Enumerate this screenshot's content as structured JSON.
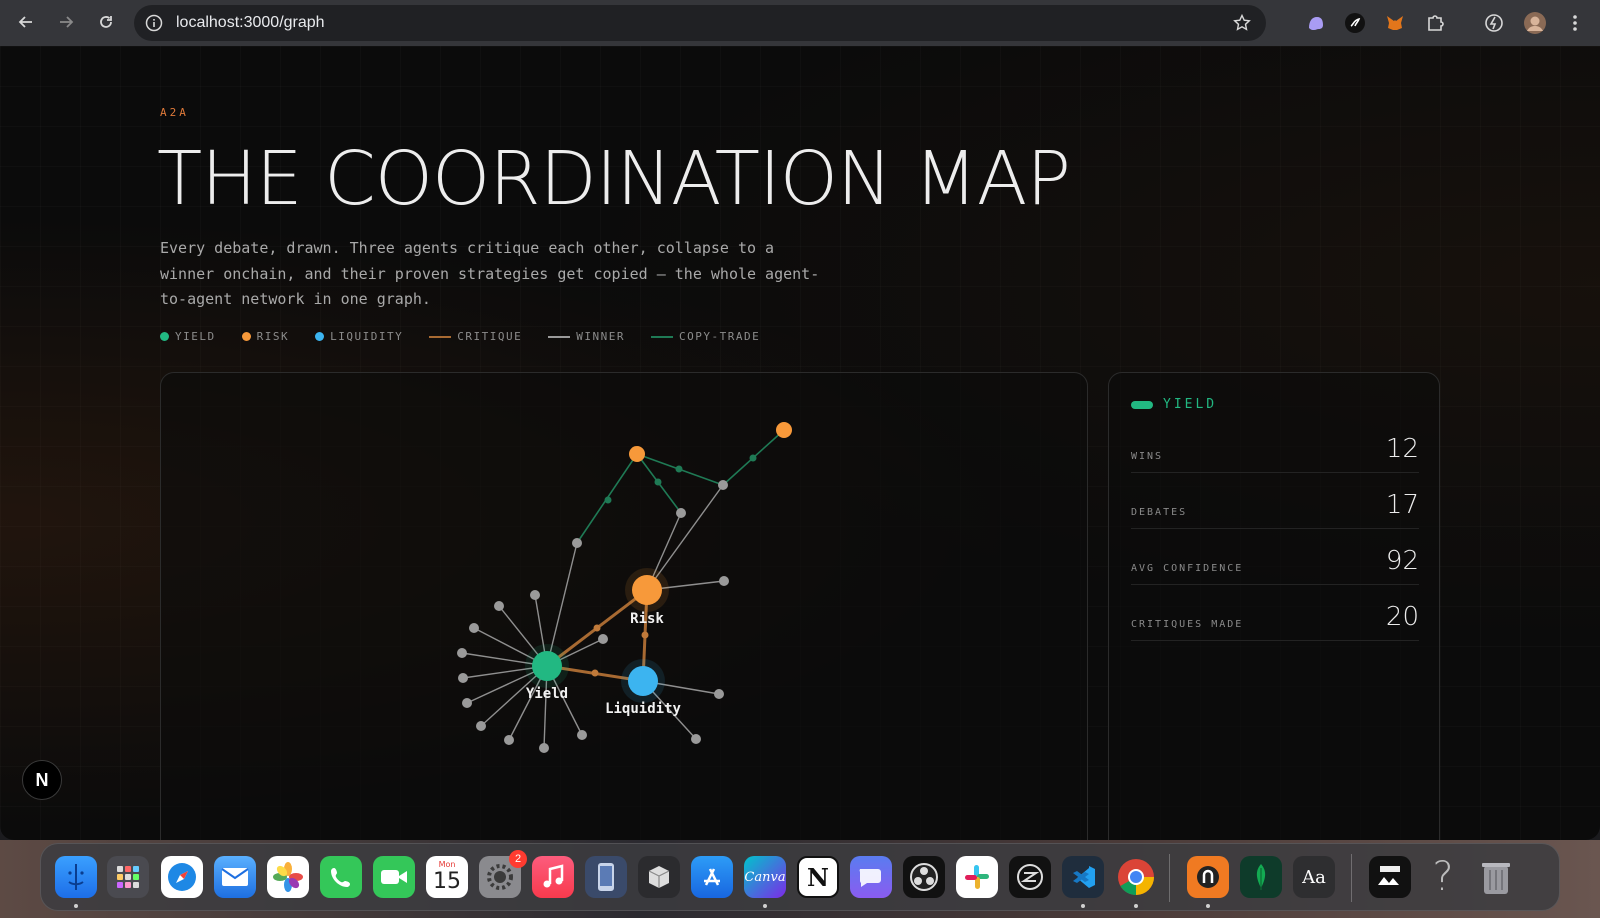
{
  "browser": {
    "url": "localhost:3000/graph"
  },
  "page": {
    "eyebrow": "A2A",
    "title": "THE COORDINATION MAP",
    "description": "Every debate, drawn. Three agents critique each other, collapse to a winner onchain, and their proven strategies get copied — the whole agent-to-agent network in one graph.",
    "legend": {
      "yield": "YIELD",
      "risk": "RISK",
      "liquidity": "LIQUIDITY",
      "critique": "CRITIQUE",
      "winner": "WINNER",
      "copy_trade": "COPY-TRADE"
    },
    "colors": {
      "yield": "#22b882",
      "risk": "#f7993a",
      "liquidity": "#3cb4f0",
      "critique": "#a86a32",
      "winner": "#9a9a9a",
      "copy_trade": "#1f7a55",
      "accent": "#e07a3a"
    }
  },
  "graph": {
    "agents": {
      "yield": "Yield",
      "risk": "Risk",
      "liquidity": "Liquidity"
    }
  },
  "side_panel": {
    "title": "YIELD",
    "stats": [
      {
        "label": "WINS",
        "value": "12"
      },
      {
        "label": "DEBATES",
        "value": "17"
      },
      {
        "label": "AVG CONFIDENCE",
        "value": "92"
      },
      {
        "label": "CRITIQUES MADE",
        "value": "20"
      }
    ]
  },
  "next_badge": "N",
  "dock": {
    "calendar_day": "15",
    "calendar_weekday": "Mon",
    "settings_badge": "2",
    "canva_label": "Canva",
    "notion_label": "N",
    "dictionary_label": "Aa",
    "help_label": "?"
  }
}
